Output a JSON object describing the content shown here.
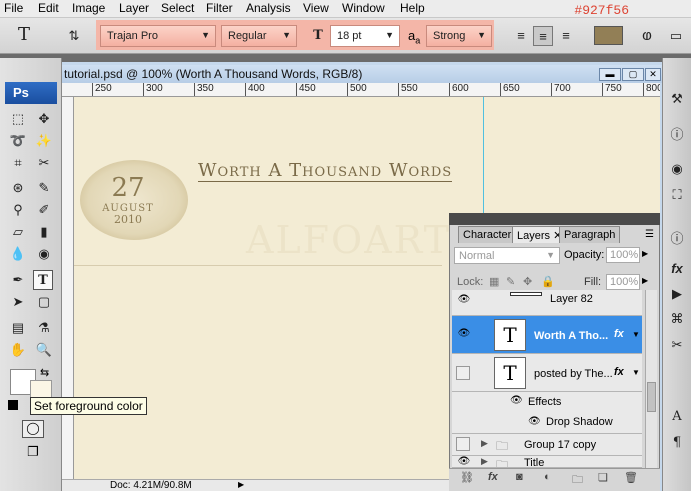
{
  "menubar": {
    "items": [
      "File",
      "Edit",
      "Image",
      "Layer",
      "Select",
      "Filter",
      "Analysis",
      "View",
      "Window",
      "Help"
    ],
    "hex_note": "#927f56"
  },
  "options": {
    "font_family": "Trajan Pro",
    "font_style": "Regular",
    "font_size": "18 pt",
    "antialias": "Strong",
    "aa_icon": "a",
    "aa_label": "a",
    "text_color": "#927f56"
  },
  "toolbox": {
    "badge": "Ps"
  },
  "document": {
    "title": "tutorial.psd @ 100% (Worth A Thousand Words, RGB/8)",
    "ruler_ticks": [
      "250",
      "300",
      "350",
      "400",
      "450",
      "500",
      "550",
      "600",
      "650",
      "700",
      "750",
      "800"
    ],
    "status": "Doc: 4.21M/90.8M"
  },
  "canvas": {
    "heading": "Worth A Thousand Words",
    "day": "27",
    "month": "AUGUST",
    "year": "2010",
    "watermark": "ALFOART"
  },
  "tooltip": "Set foreground color",
  "layers_panel": {
    "tabs": [
      "Character",
      "Layers",
      "Paragraph"
    ],
    "blend_mode": "Normal",
    "opacity_label": "Opacity:",
    "opacity": "100%",
    "lock_label": "Lock:",
    "fill_label": "Fill:",
    "fill": "100%",
    "layers": [
      {
        "name": "Layer 82"
      },
      {
        "name": "Worth A Tho...",
        "fx": "fx",
        "selected": true
      },
      {
        "name": "posted by The...",
        "fx": "fx"
      },
      {
        "name": "Effects"
      },
      {
        "name": "Drop Shadow"
      },
      {
        "name": "Group 17 copy"
      },
      {
        "name": "Title"
      }
    ]
  },
  "colors": {
    "accent": "#927f56",
    "selection": "#3a8ee6",
    "canvas_bg": "#f3ecd4"
  }
}
